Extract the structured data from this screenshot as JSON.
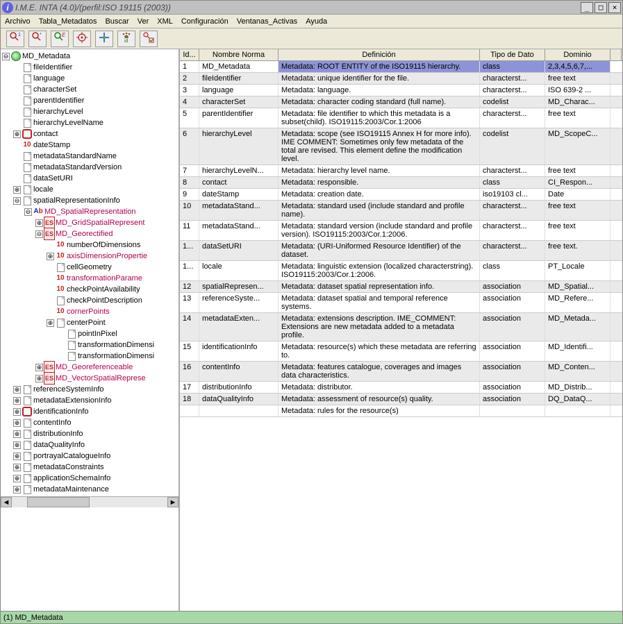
{
  "window": {
    "title": "I.M.E. INTA (4.0)/(perfil:ISO 19115 (2003))"
  },
  "menu": [
    "Archivo",
    "Tabla_Metadatos",
    "Buscar",
    "Ver",
    "XML",
    "Configuración",
    "Ventanas_Activas",
    "Ayuda"
  ],
  "toolbar_icons": [
    "find-first",
    "find-all",
    "find-e",
    "target",
    "center",
    "paw-id",
    "check-list"
  ],
  "tree": [
    {
      "d": 0,
      "t": "o",
      "i": "globe",
      "l": "MD_Metadata"
    },
    {
      "d": 1,
      "t": " ",
      "i": "doc",
      "l": "fileIdentifier"
    },
    {
      "d": 1,
      "t": " ",
      "i": "doc",
      "l": "language"
    },
    {
      "d": 1,
      "t": " ",
      "i": "doc",
      "l": "characterSet"
    },
    {
      "d": 1,
      "t": " ",
      "i": "doc",
      "l": "parentIdentifier"
    },
    {
      "d": 1,
      "t": " ",
      "i": "doc",
      "l": "hierarchyLevel"
    },
    {
      "d": 1,
      "t": " ",
      "i": "doc",
      "l": "hierarchyLevelName"
    },
    {
      "d": 1,
      "t": "c",
      "i": "red",
      "l": "contact"
    },
    {
      "d": 1,
      "t": " ",
      "i": "num",
      "l": "dateStamp"
    },
    {
      "d": 1,
      "t": " ",
      "i": "doc",
      "l": "metadataStandardName"
    },
    {
      "d": 1,
      "t": " ",
      "i": "doc",
      "l": "metadataStandardVersion"
    },
    {
      "d": 1,
      "t": " ",
      "i": "doc",
      "l": "dataSetURI"
    },
    {
      "d": 1,
      "t": "c",
      "i": "doc",
      "l": "locale"
    },
    {
      "d": 1,
      "t": "o",
      "i": "doc",
      "l": "spatialRepresentationInfo"
    },
    {
      "d": 2,
      "t": "o",
      "i": "ab",
      "l": "MD_SpatialRepresentation",
      "red": true
    },
    {
      "d": 3,
      "t": "c",
      "i": "es",
      "l": "MD_GridSpatialRepresent",
      "red": true
    },
    {
      "d": 3,
      "t": "o",
      "i": "es",
      "l": "MD_Georectified",
      "red": true
    },
    {
      "d": 4,
      "t": " ",
      "i": "num",
      "l": "numberOfDimensions"
    },
    {
      "d": 4,
      "t": "c",
      "i": "num",
      "l": "axisDimensionPropertie",
      "red": true
    },
    {
      "d": 4,
      "t": " ",
      "i": "doc",
      "l": "cellGeometry"
    },
    {
      "d": 4,
      "t": " ",
      "i": "num",
      "l": "transformationParame",
      "red": true
    },
    {
      "d": 4,
      "t": " ",
      "i": "num",
      "l": "checkPointAvailability"
    },
    {
      "d": 4,
      "t": " ",
      "i": "doc",
      "l": "checkPointDescription"
    },
    {
      "d": 4,
      "t": " ",
      "i": "num",
      "l": "cornerPoints",
      "red": true
    },
    {
      "d": 4,
      "t": "c",
      "i": "doc",
      "l": "centerPoint"
    },
    {
      "d": 5,
      "t": " ",
      "i": "doc",
      "l": "pointInPixel"
    },
    {
      "d": 5,
      "t": " ",
      "i": "doc",
      "l": "transformationDimensi"
    },
    {
      "d": 5,
      "t": " ",
      "i": "doc",
      "l": "transformationDimensi"
    },
    {
      "d": 3,
      "t": "c",
      "i": "es",
      "l": "MD_Georeferenceable",
      "red": true
    },
    {
      "d": 3,
      "t": "c",
      "i": "es",
      "l": "MD_VectorSpatialReprese",
      "red": true
    },
    {
      "d": 1,
      "t": "c",
      "i": "doc",
      "l": "referenceSystemInfo"
    },
    {
      "d": 1,
      "t": "c",
      "i": "doc",
      "l": "metadataExtensionInfo"
    },
    {
      "d": 1,
      "t": "c",
      "i": "red",
      "l": "identificationInfo"
    },
    {
      "d": 1,
      "t": "c",
      "i": "doc",
      "l": "contentInfo"
    },
    {
      "d": 1,
      "t": "c",
      "i": "doc",
      "l": "distributionInfo"
    },
    {
      "d": 1,
      "t": "c",
      "i": "doc",
      "l": "dataQualityInfo"
    },
    {
      "d": 1,
      "t": "c",
      "i": "doc",
      "l": "portrayalCatalogueInfo"
    },
    {
      "d": 1,
      "t": "c",
      "i": "doc",
      "l": "metadataConstraints"
    },
    {
      "d": 1,
      "t": "c",
      "i": "doc",
      "l": "applicationSchemaInfo"
    },
    {
      "d": 1,
      "t": "c",
      "i": "doc",
      "l": "metadataMaintenance"
    }
  ],
  "table": {
    "headers": [
      "Id...",
      "Nombre Norma",
      "Definición",
      "Tipo de Dato",
      "Dominio"
    ],
    "rows": [
      {
        "id": "1",
        "n": "MD_Metadata",
        "d": "Metadata: ROOT ENTITY of the ISO19115 hierarchy.",
        "t": "class",
        "dom": "2,3,4,5,6,7,...",
        "sel": true
      },
      {
        "id": "2",
        "n": "fileIdentifier",
        "d": "Metadata: unique identifier for the file.",
        "t": "characterst...",
        "dom": "free text"
      },
      {
        "id": "3",
        "n": "language",
        "d": "Metadata: language.",
        "t": "characterst...",
        "dom": "ISO 639-2 ..."
      },
      {
        "id": "4",
        "n": "characterSet",
        "d": "Metadata: character coding standard (full name).",
        "t": "codelist",
        "dom": "MD_Charac..."
      },
      {
        "id": "5",
        "n": "parentIdentifier",
        "d": "Metadata: file identifier to which this metadata is a subset(child). ISO19115:2003/Cor.1:2006",
        "t": "characterst...",
        "dom": "free text"
      },
      {
        "id": "6",
        "n": "hierarchyLevel",
        "d": "Metadata: scope (see ISO19115 Annex H for more info). IME COMMENT: Sometimes only few metadata of the total are revised. This element define the modification level.",
        "t": "codelist",
        "dom": "MD_ScopeC..."
      },
      {
        "id": "7",
        "n": "hierarchyLevelN...",
        "d": "Metadata: hierarchy level name.",
        "t": "characterst...",
        "dom": "free text"
      },
      {
        "id": "8",
        "n": "contact",
        "d": "Metadata: responsible.",
        "t": "class",
        "dom": "CI_Respon..."
      },
      {
        "id": "9",
        "n": "dateStamp",
        "d": "Metadata: creation date.",
        "t": "iso19103 cl...",
        "dom": "Date"
      },
      {
        "id": "10",
        "n": "metadataStand...",
        "d": "Metadata: standard used (include standard and profile name).",
        "t": "characterst...",
        "dom": "free text"
      },
      {
        "id": "11",
        "n": "metadataStand...",
        "d": "Metadata: standard version (include standard and profile version). ISO19115:2003/Cor.1:2006.",
        "t": "characterst...",
        "dom": "free text"
      },
      {
        "id": "1...",
        "n": "dataSetURI",
        "d": "Metadata: (URI-Uniformed Resource Identifier) of the dataset.",
        "t": "characterst...",
        "dom": "free text."
      },
      {
        "id": "1...",
        "n": "locale",
        "d": "Metadata: linguistic extension (localized characterstring). ISO19115:2003/Cor.1:2006.",
        "t": "class",
        "dom": "PT_Locale"
      },
      {
        "id": "12",
        "n": "spatialRepresen...",
        "d": "Metadata: dataset spatial representation info.",
        "t": "association",
        "dom": "MD_Spatial..."
      },
      {
        "id": "13",
        "n": "referenceSyste...",
        "d": "Metadata: dataset spatial and temporal reference systems.",
        "t": "association",
        "dom": "MD_Refere..."
      },
      {
        "id": "14",
        "n": "metadataExten...",
        "d": "Metadata: extensions description. IME_COMMENT: Extensions are new metadata added to a metadata profile.",
        "t": "association",
        "dom": "MD_Metada..."
      },
      {
        "id": "15",
        "n": "identificationInfo",
        "d": "Metadata: resource(s) which these metadata are referring to.",
        "t": "association",
        "dom": "MD_Identifi..."
      },
      {
        "id": "16",
        "n": "contentInfo",
        "d": "Metadata: features catalogue, coverages and images data characteristics.",
        "t": "association",
        "dom": "MD_Conten..."
      },
      {
        "id": "17",
        "n": "distributionInfo",
        "d": "Metadata: distributor.",
        "t": "association",
        "dom": "MD_Distrib..."
      },
      {
        "id": "18",
        "n": "dataQualityInfo",
        "d": "Metadata: assessment of resource(s) quality.",
        "t": "association",
        "dom": "DQ_DataQ..."
      },
      {
        "id": "",
        "n": "",
        "d": "Metadata: rules for the resource(s)",
        "t": "",
        "dom": ""
      }
    ]
  },
  "status": "(1) MD_Metadata"
}
